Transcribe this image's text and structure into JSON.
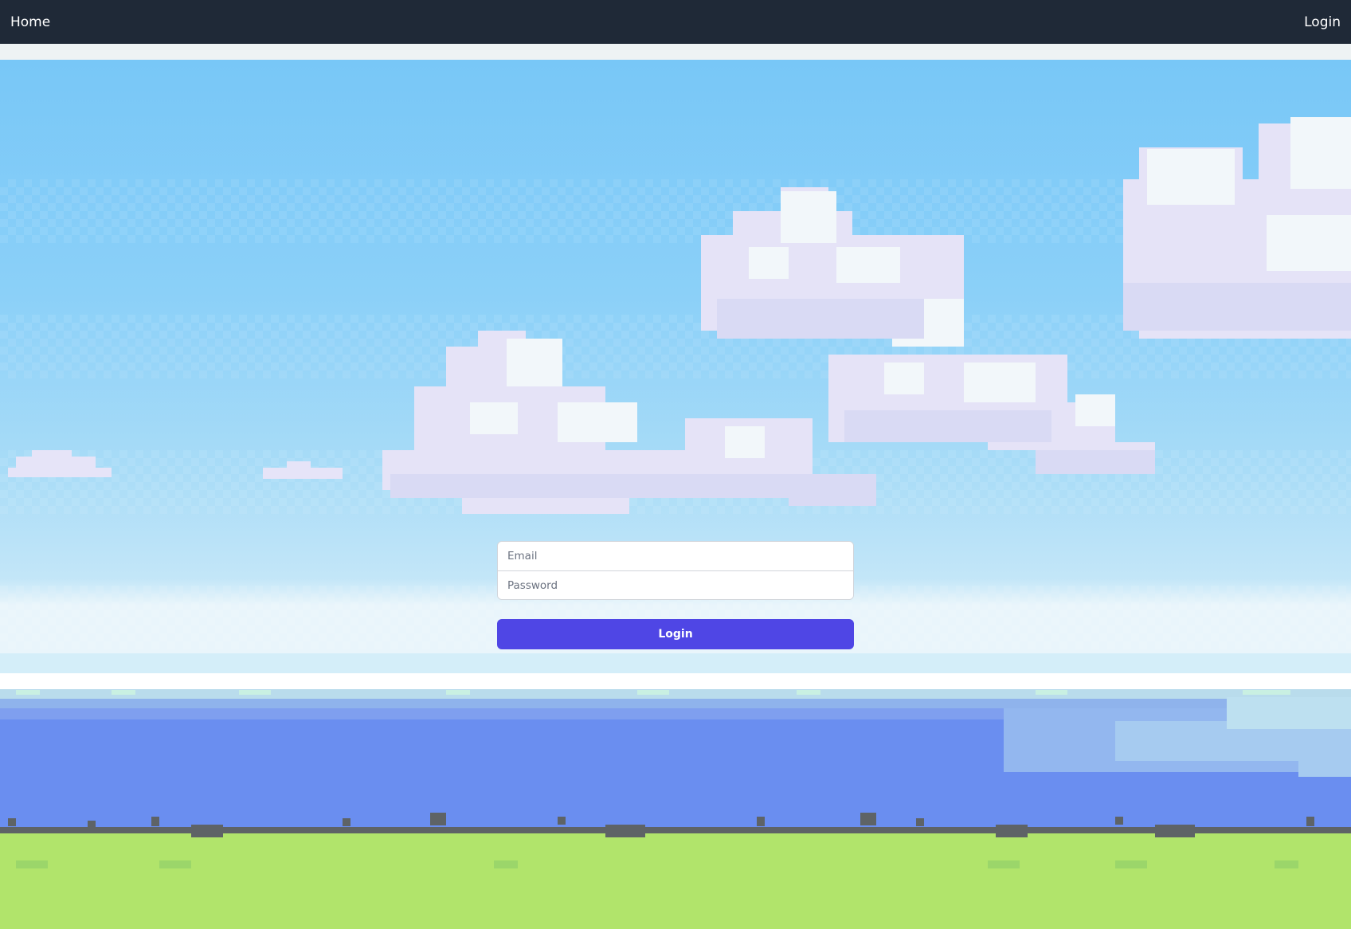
{
  "nav": {
    "home_label": "Home",
    "login_label": "Login"
  },
  "form": {
    "email_placeholder": "Email",
    "password_placeholder": "Password",
    "submit_label": "Login"
  },
  "colors": {
    "navbar": "#1f2937",
    "button": "#4f46e5",
    "sky_top": "#78c7f7",
    "sky_bottom": "#c3e6f8",
    "water": "#6a8ef0",
    "grass": "#b1e46b"
  }
}
